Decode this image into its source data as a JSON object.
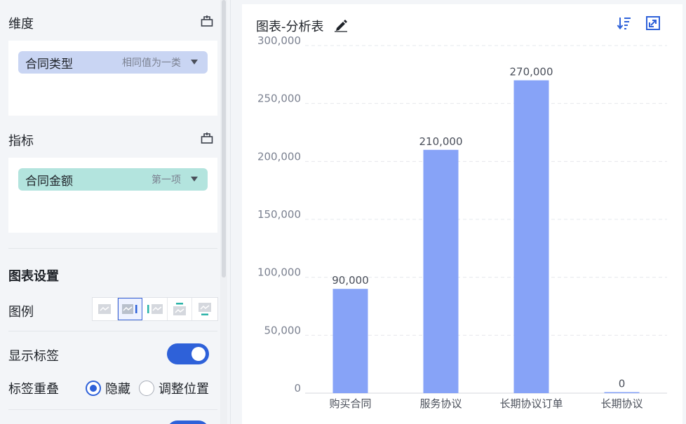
{
  "left_panel": {
    "dimension": {
      "title": "维度",
      "field": {
        "name": "合同类型",
        "hint": "相同值为一类",
        "color": "#c9d5f3"
      }
    },
    "metric": {
      "title": "指标",
      "field": {
        "name": "合同金额",
        "hint": "第一项",
        "color": "#b3e4de"
      }
    },
    "chart_settings": {
      "title": "图表设置",
      "legend_label": "图例",
      "legend_options": [
        "legend-none-icon",
        "legend-right-icon",
        "legend-left-icon",
        "legend-top-icon",
        "legend-bottom-icon"
      ],
      "legend_selected_index": 1,
      "show_labels_label": "显示标签",
      "show_labels_on": true,
      "overlap_label": "标签重叠",
      "overlap_options": [
        "隐藏",
        "调整位置"
      ],
      "overlap_selected": "隐藏"
    }
  },
  "chart_panel": {
    "title": "图表-分析表",
    "actions": [
      "sort-icon",
      "expand-icon"
    ]
  },
  "chart_data": {
    "type": "bar",
    "categories": [
      "购买合同",
      "服务协议",
      "长期协议订单",
      "长期协议"
    ],
    "values": [
      90000,
      210000,
      270000,
      0
    ],
    "data_labels": [
      "90,000",
      "210,000",
      "270,000",
      "0"
    ],
    "ylim": [
      0,
      300000
    ],
    "yticks": [
      "0",
      "50,000",
      "100,000",
      "150,000",
      "200,000",
      "250,000",
      "300,000"
    ],
    "ytick_values": [
      0,
      50000,
      100000,
      150000,
      200000,
      250000,
      300000
    ],
    "grid": true,
    "bar_color": "#87a3f7"
  },
  "colors": {
    "accent": "#2e61d9",
    "bar": "#87a3f7"
  }
}
